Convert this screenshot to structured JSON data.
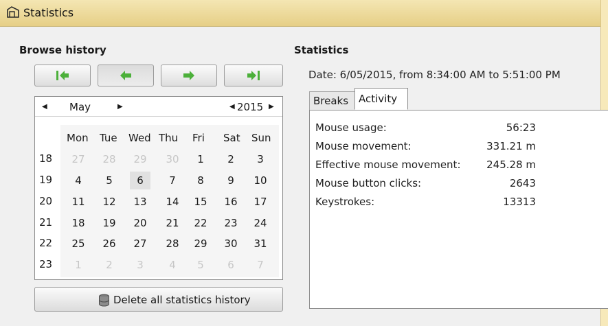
{
  "window": {
    "title": "Statistics"
  },
  "browse": {
    "heading": "Browse history",
    "calendar": {
      "month": "May",
      "year": "2015",
      "weekday_headers": [
        "Mon",
        "Tue",
        "Wed",
        "Thu",
        "Fri",
        "Sat",
        "Sun"
      ],
      "weeks": [
        {
          "number": "18",
          "days": [
            {
              "d": "27",
              "other": true
            },
            {
              "d": "28",
              "other": true
            },
            {
              "d": "29",
              "other": true
            },
            {
              "d": "30",
              "other": true
            },
            {
              "d": "1"
            },
            {
              "d": "2"
            },
            {
              "d": "3"
            }
          ]
        },
        {
          "number": "19",
          "days": [
            {
              "d": "4"
            },
            {
              "d": "5"
            },
            {
              "d": "6",
              "selected": true
            },
            {
              "d": "7"
            },
            {
              "d": "8"
            },
            {
              "d": "9"
            },
            {
              "d": "10"
            }
          ]
        },
        {
          "number": "20",
          "days": [
            {
              "d": "11"
            },
            {
              "d": "12"
            },
            {
              "d": "13"
            },
            {
              "d": "14"
            },
            {
              "d": "15"
            },
            {
              "d": "16"
            },
            {
              "d": "17"
            }
          ]
        },
        {
          "number": "21",
          "days": [
            {
              "d": "18"
            },
            {
              "d": "19"
            },
            {
              "d": "20"
            },
            {
              "d": "21"
            },
            {
              "d": "22"
            },
            {
              "d": "23"
            },
            {
              "d": "24"
            }
          ]
        },
        {
          "number": "22",
          "days": [
            {
              "d": "25"
            },
            {
              "d": "26"
            },
            {
              "d": "27"
            },
            {
              "d": "28"
            },
            {
              "d": "29"
            },
            {
              "d": "30"
            },
            {
              "d": "31"
            }
          ]
        },
        {
          "number": "23",
          "days": [
            {
              "d": "1",
              "other": true
            },
            {
              "d": "2",
              "other": true
            },
            {
              "d": "3",
              "other": true
            },
            {
              "d": "4",
              "other": true
            },
            {
              "d": "5",
              "other": true
            },
            {
              "d": "6",
              "other": true
            },
            {
              "d": "7",
              "other": true
            }
          ]
        }
      ]
    },
    "delete_label": "Delete all statistics history",
    "accent_green": "#4cb03a"
  },
  "stats": {
    "heading": "Statistics",
    "date_line": "Date: 6/05/2015, from 8:34:00 AM to 5:51:00 PM",
    "tabs": [
      {
        "label": "Breaks"
      },
      {
        "label": "Activity",
        "active": true
      }
    ],
    "rows": [
      {
        "label": "Mouse usage:",
        "value": "56:23"
      },
      {
        "label": "Mouse movement:",
        "value": "331.21 m"
      },
      {
        "label": "Effective mouse movement:",
        "value": "245.28 m"
      },
      {
        "label": "Mouse button clicks:",
        "value": "2643"
      },
      {
        "label": "Keystrokes:",
        "value": "13313"
      }
    ]
  }
}
